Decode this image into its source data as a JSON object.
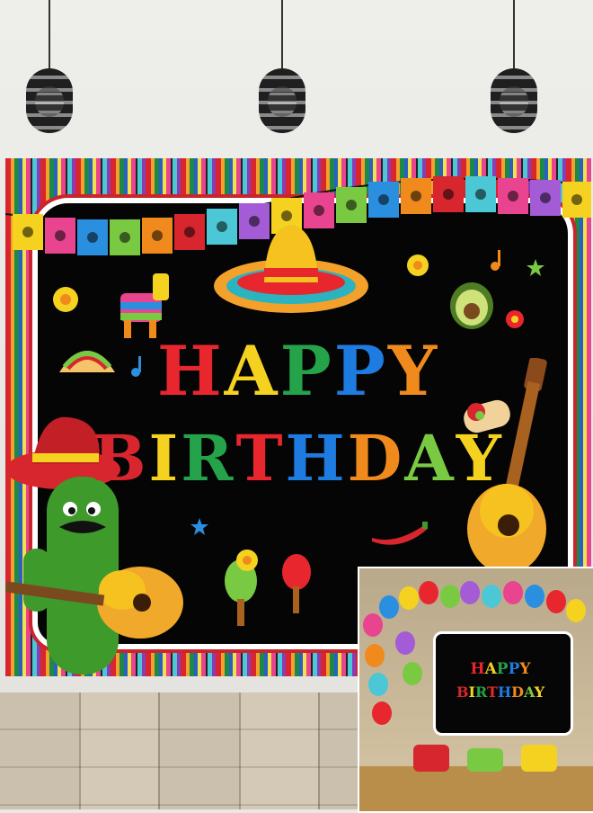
{
  "backdrop": {
    "title_line1": "HAPPY",
    "title_line2": "BIRTHDAY",
    "letter_colors": [
      "#e8262e",
      "#f5d21f",
      "#24a34a",
      "#1e7be0",
      "#f08a1d",
      "#d7262e",
      "#f5d21f",
      "#24a34a",
      "#e8262e",
      "#1e7be0",
      "#f08a1d",
      "#7ac943",
      "#f5d21f"
    ]
  },
  "inset_photo": {
    "title_line1": "HAPPY",
    "title_line2": "BIRTHDAY"
  },
  "icons": [
    "pendant-lamp-icon",
    "papel-picado-flag-icon",
    "sombrero-icon",
    "pinata-icon",
    "avocado-icon",
    "taco-icon",
    "burrito-icon",
    "guitar-icon",
    "cactus-mariachi-icon",
    "maraca-icon",
    "chili-pepper-icon",
    "flower-icon",
    "music-note-icon",
    "star-icon",
    "balloon-icon"
  ],
  "colors": {
    "background_black": "#050505",
    "frame_white": "#ffffff",
    "frame_red": "#c9252c",
    "wall": "#e9e8e4",
    "floor": "#cbbfae"
  }
}
